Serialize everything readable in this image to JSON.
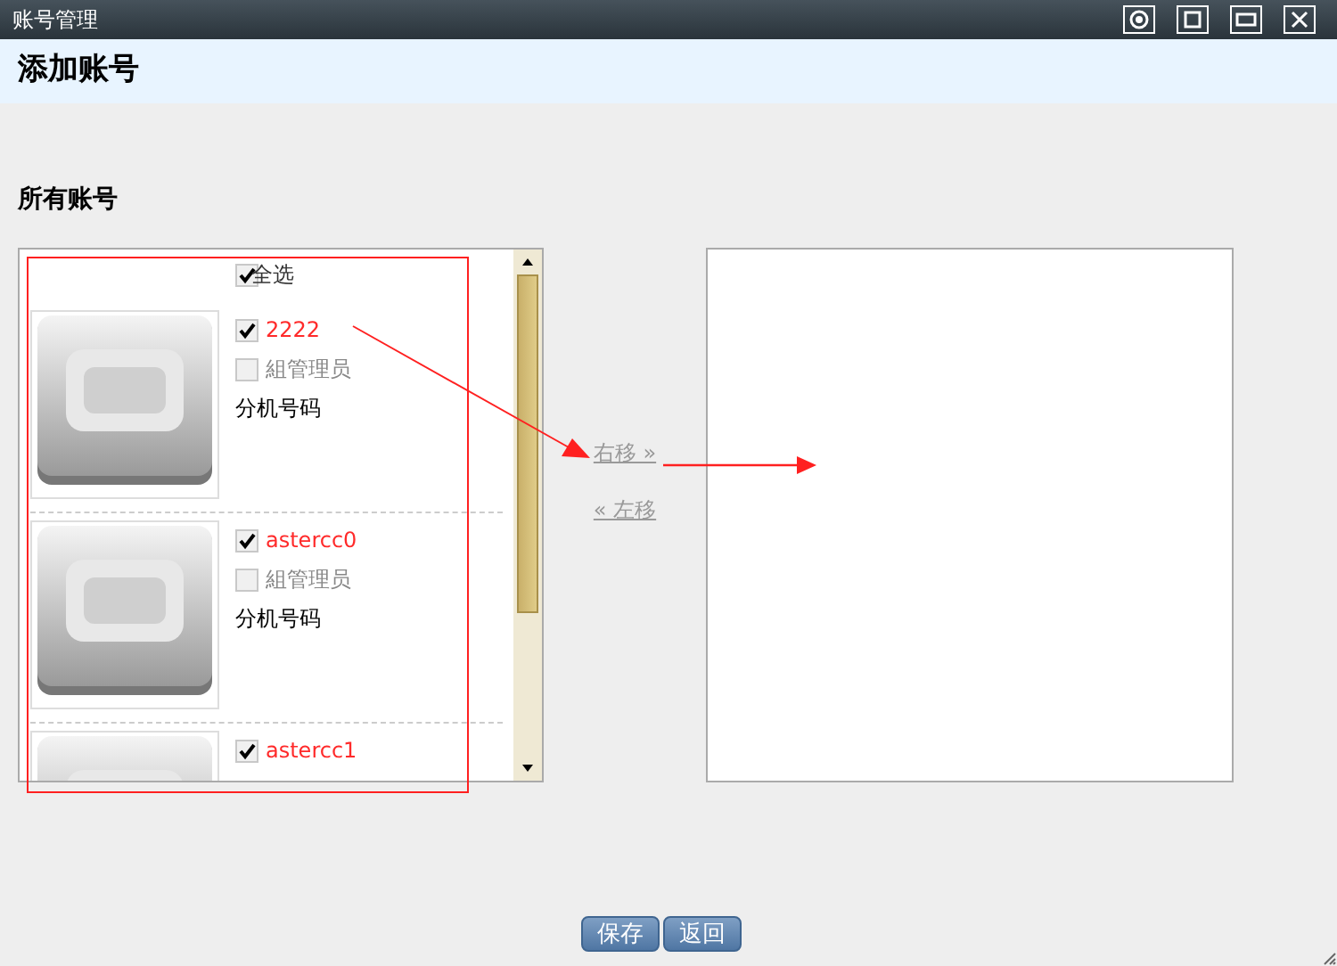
{
  "window": {
    "title": "账号管理"
  },
  "header": {
    "title": "添加账号"
  },
  "section_label": "所有账号",
  "select_all": {
    "label": "全选",
    "checked": true
  },
  "accounts": [
    {
      "name": "2222",
      "checked": true,
      "group_admin": {
        "label": "組管理员",
        "checked": false
      },
      "extension_label": "分机号码"
    },
    {
      "name": "astercc0",
      "checked": true,
      "group_admin": {
        "label": "組管理员",
        "checked": false
      },
      "extension_label": "分机号码"
    },
    {
      "name": "astercc1",
      "checked": true
    }
  ],
  "move_right": "右移 »",
  "move_left": "« 左移",
  "buttons": [
    "保存",
    "返回"
  ]
}
